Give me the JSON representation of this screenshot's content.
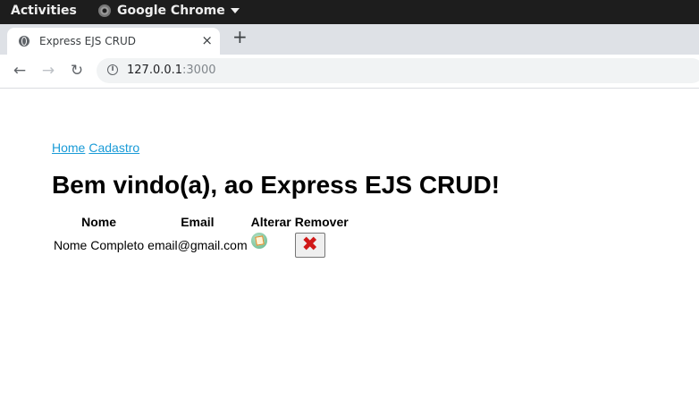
{
  "topbar": {
    "activities": "Activities",
    "app_name": "Google Chrome"
  },
  "browser": {
    "tab_title": "Express EJS CRUD",
    "tab_close": "×",
    "new_tab": "+",
    "back": "←",
    "forward": "→",
    "reload": "↻",
    "url_host": "127.0.0.1",
    "url_port": ":3000",
    "info_glyph": "i"
  },
  "page": {
    "nav": [
      {
        "label": "Home"
      },
      {
        "label": "Cadastro"
      }
    ],
    "heading": "Bem vindo(a), ao Express EJS CRUD!",
    "table": {
      "headers": [
        "Nome",
        "Email",
        "Alterar",
        "Remover"
      ],
      "rows": [
        {
          "nome": "Nome Completo",
          "email": "email@gmail.com",
          "alterar_icon": "edit-icon",
          "remover_icon": "red-x-icon",
          "remover_glyph": "✖"
        }
      ]
    }
  },
  "colors": {
    "link": "#1a9bd7",
    "topbar": "#1d1d1d",
    "remove_x": "#d01818"
  }
}
